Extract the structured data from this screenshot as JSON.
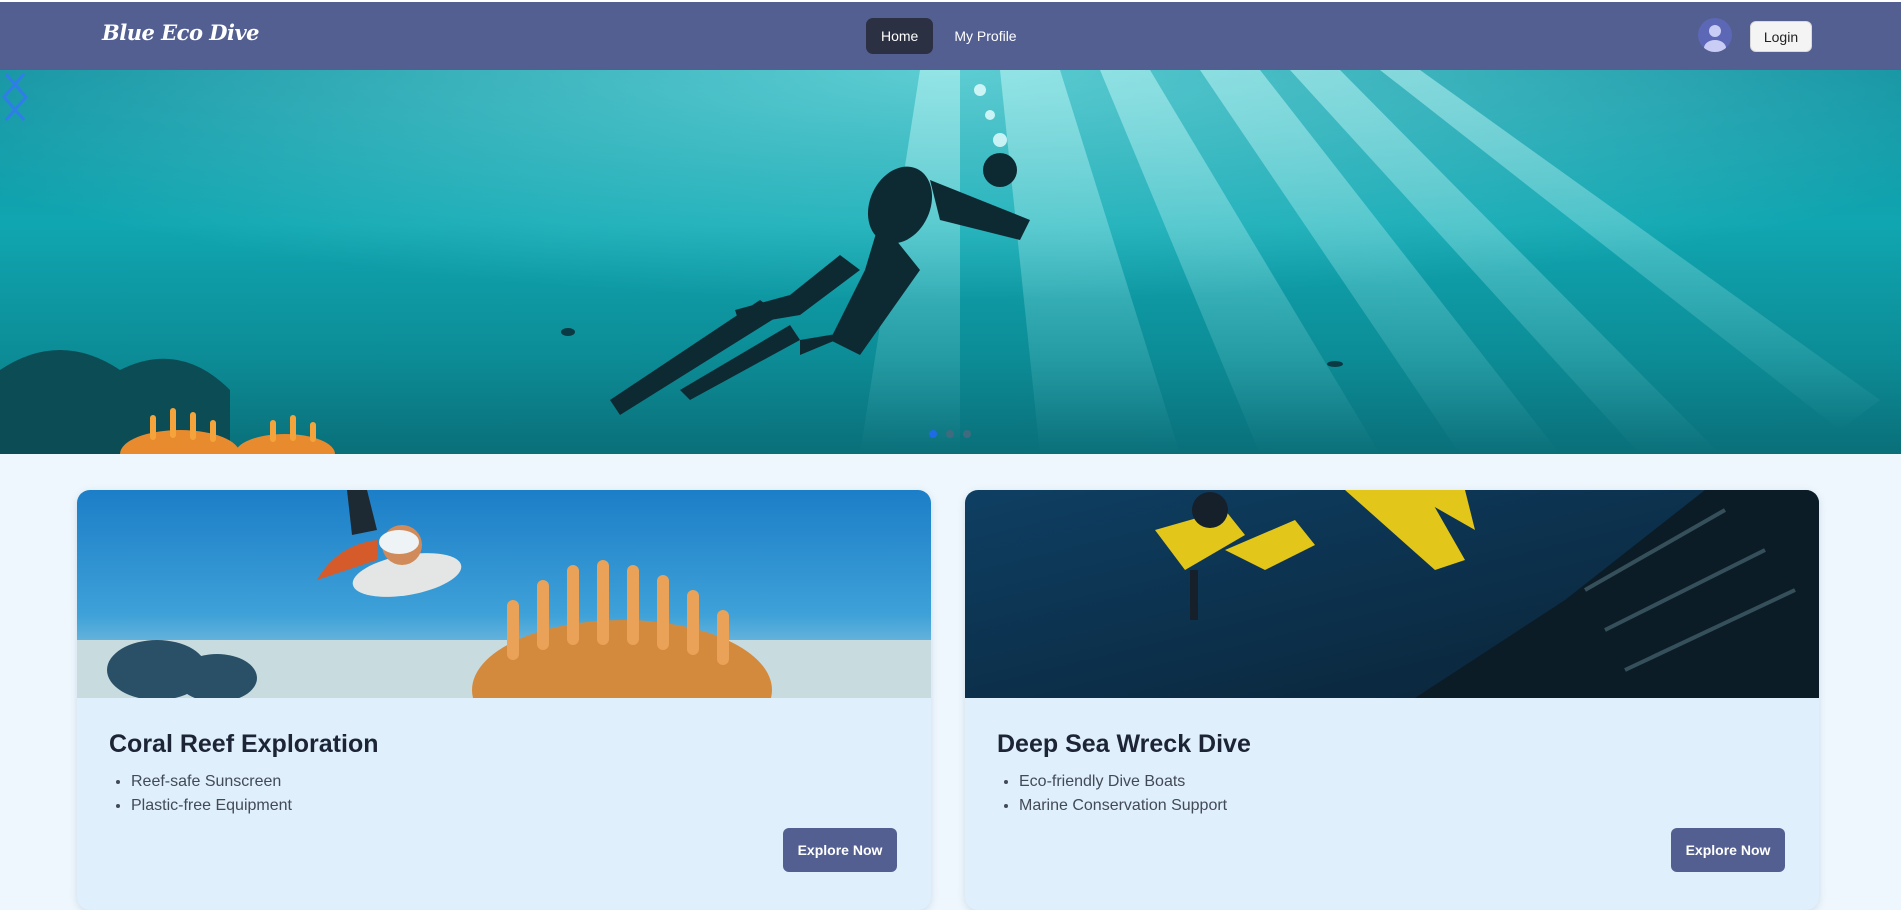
{
  "brand": {
    "name": "Blue Eco Dive"
  },
  "nav": {
    "links": [
      {
        "label": "Home",
        "active": true
      },
      {
        "label": "My Profile",
        "active": false
      }
    ],
    "login_label": "Login"
  },
  "hero": {
    "slide_count": 3,
    "active_slide": 1
  },
  "cards": [
    {
      "title": "Coral Reef Exploration",
      "features": [
        "Reef-safe Sunscreen",
        "Plastic-free Equipment"
      ],
      "button_label": "Explore Now"
    },
    {
      "title": "Deep Sea Wreck Dive",
      "features": [
        "Eco-friendly Dive Boats",
        "Marine Conservation Support"
      ],
      "button_label": "Explore Now"
    }
  ],
  "colors": {
    "navbar": "#535f91",
    "active_nav": "#2b3042",
    "button": "#535f91",
    "page_bg": "#eef7fd",
    "card_bg": "#dfeffb"
  },
  "icons": {
    "avatar": "user-avatar-icon",
    "prev": "chevron-left-icon",
    "next": "chevron-right-icon"
  }
}
